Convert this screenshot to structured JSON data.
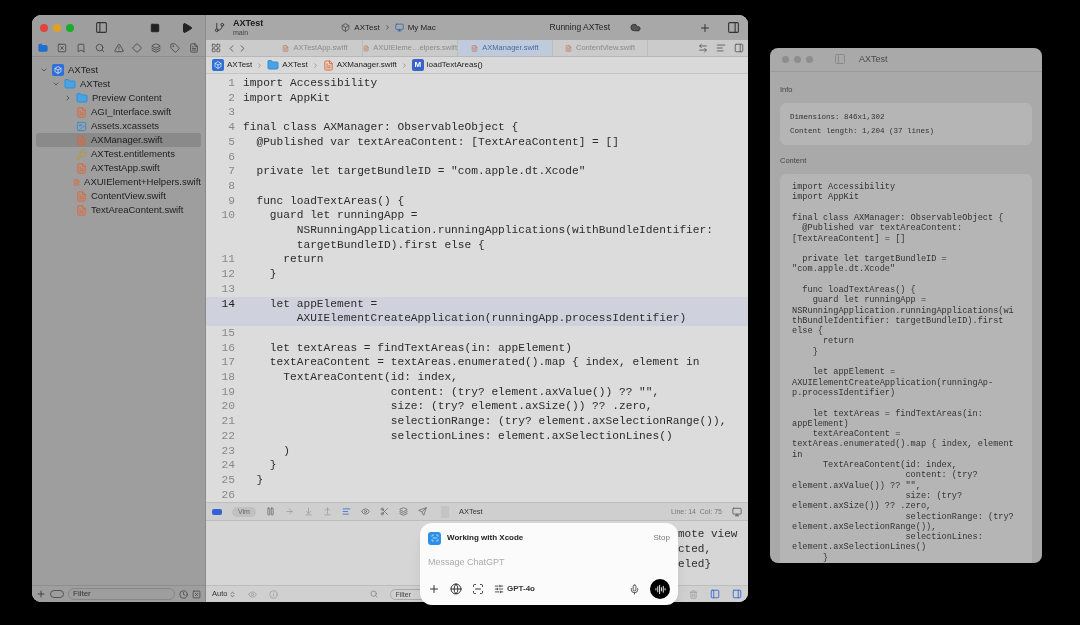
{
  "window": {
    "project": "AXTest",
    "branch": "main",
    "scheme": "AXTest",
    "destination": "My Mac",
    "status": "Running AXTest"
  },
  "navigator": {
    "items": [
      {
        "name": "AXTest",
        "kind": "project",
        "expanded": true,
        "selected": false,
        "children": [
          {
            "name": "AXTest",
            "kind": "folder",
            "expanded": true,
            "selected": false,
            "children": [
              {
                "name": "Preview Content",
                "kind": "folder",
                "expanded": false,
                "selected": false
              },
              {
                "name": "AGI_Interface.swift",
                "kind": "swift",
                "selected": false
              },
              {
                "name": "Assets.xcassets",
                "kind": "assets",
                "selected": false
              },
              {
                "name": "AXManager.swift",
                "kind": "swift",
                "selected": true
              },
              {
                "name": "AXTest.entitlements",
                "kind": "entitlements",
                "selected": false
              },
              {
                "name": "AXTestApp.swift",
                "kind": "swift",
                "selected": false
              },
              {
                "name": "AXUIElement+Helpers.swift",
                "kind": "swift",
                "selected": false
              },
              {
                "name": "ContentView.swift",
                "kind": "swift",
                "selected": false
              },
              {
                "name": "TextAreaContent.swift",
                "kind": "swift",
                "selected": false
              }
            ]
          }
        ]
      }
    ],
    "filter_placeholder": "Filter"
  },
  "tabs": [
    {
      "label": "AXTestApp.swift",
      "selected": false
    },
    {
      "label": "AXUIEleme…elpers.swift",
      "selected": false
    },
    {
      "label": "AXManager.swift",
      "selected": true
    },
    {
      "label": "ContentView.swift",
      "selected": false
    }
  ],
  "breadcrumb": [
    {
      "label": "AXTest",
      "kind": "project"
    },
    {
      "label": "AXTest",
      "kind": "folder"
    },
    {
      "label": "AXManager.swift",
      "kind": "swift"
    },
    {
      "label": "loadTextAreas()",
      "kind": "method",
      "badge": "M"
    }
  ],
  "editor": {
    "lines": [
      {
        "number": "1",
        "highlighted": false,
        "rows": [
          "import Accessibility"
        ]
      },
      {
        "number": "2",
        "highlighted": false,
        "rows": [
          "import AppKit"
        ]
      },
      {
        "number": "3",
        "highlighted": false
      },
      {
        "number": "4",
        "highlighted": false,
        "rows": [
          "final class AXManager: ObservableObject {"
        ]
      },
      {
        "number": "5",
        "highlighted": false,
        "rows": [
          "  @Published var textAreaContent: [TextAreaContent] = []"
        ]
      },
      {
        "number": "6",
        "highlighted": false
      },
      {
        "number": "7",
        "highlighted": false,
        "rows": [
          "  private let targetBundleID = \"com.apple.dt.Xcode\""
        ]
      },
      {
        "number": "8",
        "highlighted": false
      },
      {
        "number": "9",
        "highlighted": false,
        "rows": [
          "  func loadTextAreas() {"
        ]
      },
      {
        "number": "10",
        "highlighted": false,
        "rows": [
          "    guard let runningApp =",
          "        NSRunningApplication.runningApplications(withBundleIdentifier:",
          "        targetBundleID).first else {"
        ]
      },
      {
        "number": "11",
        "highlighted": false,
        "rows": [
          "      return"
        ]
      },
      {
        "number": "12",
        "highlighted": false,
        "rows": [
          "    }"
        ]
      },
      {
        "number": "13",
        "highlighted": false
      },
      {
        "number": "14",
        "highlighted": true,
        "rows": [
          "    let appElement =",
          "        AXUIElementCreateApplication(runningApp.processIdentifier)"
        ]
      },
      {
        "number": "15",
        "highlighted": false
      },
      {
        "number": "16",
        "highlighted": false,
        "rows": [
          "    let textAreas = findTextAreas(in: appElement)"
        ]
      },
      {
        "number": "17",
        "highlighted": false,
        "rows": [
          "    textAreaContent = textAreas.enumerated().map { index, element in"
        ]
      },
      {
        "number": "18",
        "highlighted": false,
        "rows": [
          "      TextAreaContent(id: index,"
        ]
      },
      {
        "number": "19",
        "highlighted": false,
        "rows": [
          "                      content: (try? element.axValue()) ?? \"\","
        ]
      },
      {
        "number": "20",
        "highlighted": false,
        "rows": [
          "                      size: (try? element.axSize()) ?? .zero,"
        ]
      },
      {
        "number": "21",
        "highlighted": false,
        "rows": [
          "                      selectionRange: (try? element.axSelectionRange()),"
        ]
      },
      {
        "number": "22",
        "highlighted": false,
        "rows": [
          "                      selectionLines: element.axSelectionLines()"
        ]
      },
      {
        "number": "23",
        "highlighted": false,
        "rows": [
          "      )"
        ]
      },
      {
        "number": "24",
        "highlighted": false,
        "rows": [
          "    }"
        ]
      },
      {
        "number": "25",
        "highlighted": false,
        "rows": [
          "  }"
        ]
      },
      {
        "number": "26",
        "highlighted": false
      }
    ]
  },
  "debug_bar": {
    "breakpoints_on": true,
    "mode": "Vim",
    "target": "AXTest",
    "position": "Line: 14  Col: 75"
  },
  "console": {
    "lines": [
      "mote view",
      "cted,",
      "eled}"
    ],
    "scope": "Auto",
    "filter_placeholder": "Filter"
  },
  "chatgpt": {
    "title": "Working with Xcode",
    "stop": "Stop",
    "placeholder": "Message ChatGPT",
    "model": "GPT-4o"
  },
  "inspector": {
    "title": "AXTest",
    "info_heading": "Info",
    "info": [
      "Dimensions: 846x1,302",
      "Content length: 1,204 (37 lines)"
    ],
    "content_heading": "Content",
    "content": "import Accessibility\nimport AppKit\n\nfinal class AXManager: ObservableObject {\n  @Published var textAreaContent:\n[TextAreaContent] = []\n\n  private let targetBundleID =\n\"com.apple.dt.Xcode\"\n\n  func loadTextAreas() {\n    guard let runningApp =\nNSRunningApplication.runningApplications(wi\nthBundleIdentifier: targetBundleID).first\nelse {\n      return\n    }\n\n    let appElement =\nAXUIElementCreateApplication(runningAp-\np.processIdentifier)\n\n    let textAreas = findTextAreas(in:\nappElement)\n    textAreaContent =\ntextAreas.enumerated().map { index, element\nin\n      TextAreaContent(id: index,\n                      content: (try?\nelement.axValue()) ?? \"\",\n                      size: (try?\nelement.axSize()) ?? .zero,\n                      selectionRange: (try?\nelement.axSelectionRange()),\n                      selectionLines:\nelement.axSelectionLines()\n      }"
  }
}
